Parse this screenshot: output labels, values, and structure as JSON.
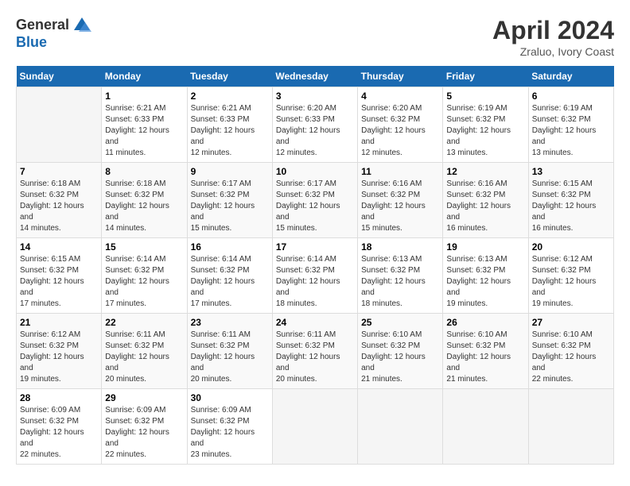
{
  "logo": {
    "general": "General",
    "blue": "Blue"
  },
  "title": {
    "month": "April 2024",
    "location": "Zraluo, Ivory Coast"
  },
  "days_of_week": [
    "Sunday",
    "Monday",
    "Tuesday",
    "Wednesday",
    "Thursday",
    "Friday",
    "Saturday"
  ],
  "weeks": [
    [
      {
        "day": null,
        "sunrise": null,
        "sunset": null,
        "daylight": null
      },
      {
        "day": "1",
        "sunrise": "Sunrise: 6:21 AM",
        "sunset": "Sunset: 6:33 PM",
        "daylight": "Daylight: 12 hours and 11 minutes."
      },
      {
        "day": "2",
        "sunrise": "Sunrise: 6:21 AM",
        "sunset": "Sunset: 6:33 PM",
        "daylight": "Daylight: 12 hours and 12 minutes."
      },
      {
        "day": "3",
        "sunrise": "Sunrise: 6:20 AM",
        "sunset": "Sunset: 6:33 PM",
        "daylight": "Daylight: 12 hours and 12 minutes."
      },
      {
        "day": "4",
        "sunrise": "Sunrise: 6:20 AM",
        "sunset": "Sunset: 6:32 PM",
        "daylight": "Daylight: 12 hours and 12 minutes."
      },
      {
        "day": "5",
        "sunrise": "Sunrise: 6:19 AM",
        "sunset": "Sunset: 6:32 PM",
        "daylight": "Daylight: 12 hours and 13 minutes."
      },
      {
        "day": "6",
        "sunrise": "Sunrise: 6:19 AM",
        "sunset": "Sunset: 6:32 PM",
        "daylight": "Daylight: 12 hours and 13 minutes."
      }
    ],
    [
      {
        "day": "7",
        "sunrise": "Sunrise: 6:18 AM",
        "sunset": "Sunset: 6:32 PM",
        "daylight": "Daylight: 12 hours and 14 minutes."
      },
      {
        "day": "8",
        "sunrise": "Sunrise: 6:18 AM",
        "sunset": "Sunset: 6:32 PM",
        "daylight": "Daylight: 12 hours and 14 minutes."
      },
      {
        "day": "9",
        "sunrise": "Sunrise: 6:17 AM",
        "sunset": "Sunset: 6:32 PM",
        "daylight": "Daylight: 12 hours and 15 minutes."
      },
      {
        "day": "10",
        "sunrise": "Sunrise: 6:17 AM",
        "sunset": "Sunset: 6:32 PM",
        "daylight": "Daylight: 12 hours and 15 minutes."
      },
      {
        "day": "11",
        "sunrise": "Sunrise: 6:16 AM",
        "sunset": "Sunset: 6:32 PM",
        "daylight": "Daylight: 12 hours and 15 minutes."
      },
      {
        "day": "12",
        "sunrise": "Sunrise: 6:16 AM",
        "sunset": "Sunset: 6:32 PM",
        "daylight": "Daylight: 12 hours and 16 minutes."
      },
      {
        "day": "13",
        "sunrise": "Sunrise: 6:15 AM",
        "sunset": "Sunset: 6:32 PM",
        "daylight": "Daylight: 12 hours and 16 minutes."
      }
    ],
    [
      {
        "day": "14",
        "sunrise": "Sunrise: 6:15 AM",
        "sunset": "Sunset: 6:32 PM",
        "daylight": "Daylight: 12 hours and 17 minutes."
      },
      {
        "day": "15",
        "sunrise": "Sunrise: 6:14 AM",
        "sunset": "Sunset: 6:32 PM",
        "daylight": "Daylight: 12 hours and 17 minutes."
      },
      {
        "day": "16",
        "sunrise": "Sunrise: 6:14 AM",
        "sunset": "Sunset: 6:32 PM",
        "daylight": "Daylight: 12 hours and 17 minutes."
      },
      {
        "day": "17",
        "sunrise": "Sunrise: 6:14 AM",
        "sunset": "Sunset: 6:32 PM",
        "daylight": "Daylight: 12 hours and 18 minutes."
      },
      {
        "day": "18",
        "sunrise": "Sunrise: 6:13 AM",
        "sunset": "Sunset: 6:32 PM",
        "daylight": "Daylight: 12 hours and 18 minutes."
      },
      {
        "day": "19",
        "sunrise": "Sunrise: 6:13 AM",
        "sunset": "Sunset: 6:32 PM",
        "daylight": "Daylight: 12 hours and 19 minutes."
      },
      {
        "day": "20",
        "sunrise": "Sunrise: 6:12 AM",
        "sunset": "Sunset: 6:32 PM",
        "daylight": "Daylight: 12 hours and 19 minutes."
      }
    ],
    [
      {
        "day": "21",
        "sunrise": "Sunrise: 6:12 AM",
        "sunset": "Sunset: 6:32 PM",
        "daylight": "Daylight: 12 hours and 19 minutes."
      },
      {
        "day": "22",
        "sunrise": "Sunrise: 6:11 AM",
        "sunset": "Sunset: 6:32 PM",
        "daylight": "Daylight: 12 hours and 20 minutes."
      },
      {
        "day": "23",
        "sunrise": "Sunrise: 6:11 AM",
        "sunset": "Sunset: 6:32 PM",
        "daylight": "Daylight: 12 hours and 20 minutes."
      },
      {
        "day": "24",
        "sunrise": "Sunrise: 6:11 AM",
        "sunset": "Sunset: 6:32 PM",
        "daylight": "Daylight: 12 hours and 20 minutes."
      },
      {
        "day": "25",
        "sunrise": "Sunrise: 6:10 AM",
        "sunset": "Sunset: 6:32 PM",
        "daylight": "Daylight: 12 hours and 21 minutes."
      },
      {
        "day": "26",
        "sunrise": "Sunrise: 6:10 AM",
        "sunset": "Sunset: 6:32 PM",
        "daylight": "Daylight: 12 hours and 21 minutes."
      },
      {
        "day": "27",
        "sunrise": "Sunrise: 6:10 AM",
        "sunset": "Sunset: 6:32 PM",
        "daylight": "Daylight: 12 hours and 22 minutes."
      }
    ],
    [
      {
        "day": "28",
        "sunrise": "Sunrise: 6:09 AM",
        "sunset": "Sunset: 6:32 PM",
        "daylight": "Daylight: 12 hours and 22 minutes."
      },
      {
        "day": "29",
        "sunrise": "Sunrise: 6:09 AM",
        "sunset": "Sunset: 6:32 PM",
        "daylight": "Daylight: 12 hours and 22 minutes."
      },
      {
        "day": "30",
        "sunrise": "Sunrise: 6:09 AM",
        "sunset": "Sunset: 6:32 PM",
        "daylight": "Daylight: 12 hours and 23 minutes."
      },
      {
        "day": null,
        "sunrise": null,
        "sunset": null,
        "daylight": null
      },
      {
        "day": null,
        "sunrise": null,
        "sunset": null,
        "daylight": null
      },
      {
        "day": null,
        "sunrise": null,
        "sunset": null,
        "daylight": null
      },
      {
        "day": null,
        "sunrise": null,
        "sunset": null,
        "daylight": null
      }
    ]
  ]
}
